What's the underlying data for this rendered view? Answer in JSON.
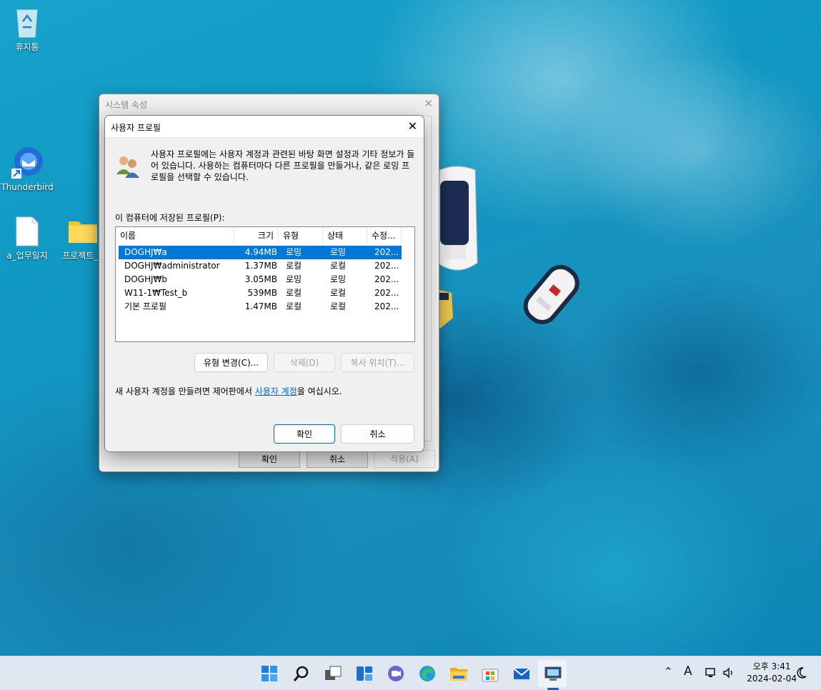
{
  "desktop": {
    "icons": [
      {
        "label": "휴지통"
      },
      {
        "label": "Thunderbird"
      },
      {
        "label": "a_업무일지"
      },
      {
        "label": "프로젝트_0"
      }
    ]
  },
  "system_dialog": {
    "title": "시스템 속성",
    "ok_label": "확인",
    "cancel_label": "취소",
    "apply_label": "적용(A)"
  },
  "profile_dialog": {
    "title": "사용자 프로필",
    "description": "사용자 프로필에는 사용자 계정과 관련된 바탕 화면 설정과 기타 정보가 들어 있습니다. 사용하는 컴퓨터마다 다른 프로필을 만들거나, 같은 로밍 프로필을 선택할 수 있습니다.",
    "list_label": "이 컴퓨터에 저장된 프로필(P):",
    "columns": [
      "이름",
      "크기",
      "유형",
      "상태",
      "수정..."
    ],
    "rows": [
      {
        "name": "DOGHJ₩a",
        "size": "4.94MB",
        "type": "로밍",
        "state": "로밍",
        "modified": "202..."
      },
      {
        "name": "DOGHJ₩administrator",
        "size": "1.37MB",
        "type": "로컬",
        "state": "로컬",
        "modified": "202..."
      },
      {
        "name": "DOGHJ₩b",
        "size": "3.05MB",
        "type": "로밍",
        "state": "로밍",
        "modified": "202..."
      },
      {
        "name": "W11-1₩Test_b",
        "size": "539MB",
        "type": "로컬",
        "state": "로컬",
        "modified": "202..."
      },
      {
        "name": "기본 프로필",
        "size": "1.47MB",
        "type": "로컬",
        "state": "로컬",
        "modified": "202..."
      }
    ],
    "change_type_label": "유형 변경(C)...",
    "delete_label": "삭제(D)",
    "copy_to_label": "복사 위치(T)...",
    "hint_prefix": "새 사용자 계정을 만들려면 제어판에서 ",
    "hint_link": "사용자 계정",
    "hint_suffix": "을 여십시오.",
    "ok_label": "확인",
    "cancel_label": "취소"
  },
  "taskbar": {
    "tray": {
      "ime": "A"
    },
    "clock": {
      "time": "오후 3:41",
      "date": "2024-02-04"
    }
  }
}
